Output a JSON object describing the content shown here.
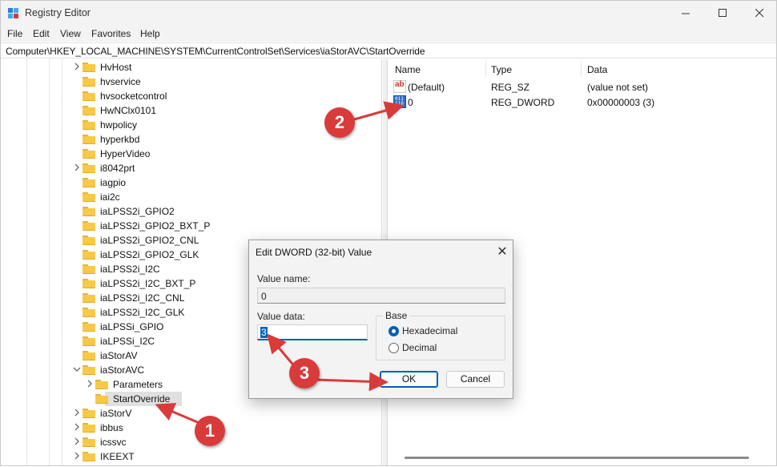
{
  "window": {
    "title": "Registry Editor",
    "minimize": "—",
    "maximize": "☐",
    "close": "✕"
  },
  "menu": [
    "File",
    "Edit",
    "View",
    "Favorites",
    "Help"
  ],
  "address": "Computer\\HKEY_LOCAL_MACHINE\\SYSTEM\\CurrentControlSet\\Services\\iaStorAVC\\StartOverride",
  "tree": [
    {
      "label": "HvHost",
      "expander": "collapsed"
    },
    {
      "label": "hvservice",
      "expander": "none"
    },
    {
      "label": "hvsocketcontrol",
      "expander": "none"
    },
    {
      "label": "HwNClx0101",
      "expander": "none"
    },
    {
      "label": "hwpolicy",
      "expander": "none"
    },
    {
      "label": "hyperkbd",
      "expander": "none"
    },
    {
      "label": "HyperVideo",
      "expander": "none"
    },
    {
      "label": "i8042prt",
      "expander": "collapsed"
    },
    {
      "label": "iagpio",
      "expander": "none"
    },
    {
      "label": "iai2c",
      "expander": "none"
    },
    {
      "label": "iaLPSS2i_GPIO2",
      "expander": "none"
    },
    {
      "label": "iaLPSS2i_GPIO2_BXT_P",
      "expander": "none"
    },
    {
      "label": "iaLPSS2i_GPIO2_CNL",
      "expander": "none"
    },
    {
      "label": "iaLPSS2i_GPIO2_GLK",
      "expander": "none"
    },
    {
      "label": "iaLPSS2i_I2C",
      "expander": "none"
    },
    {
      "label": "iaLPSS2i_I2C_BXT_P",
      "expander": "none"
    },
    {
      "label": "iaLPSS2i_I2C_CNL",
      "expander": "none"
    },
    {
      "label": "iaLPSS2i_I2C_GLK",
      "expander": "none"
    },
    {
      "label": "iaLPSSi_GPIO",
      "expander": "none"
    },
    {
      "label": "iaLPSSi_I2C",
      "expander": "none"
    },
    {
      "label": "iaStorAV",
      "expander": "none"
    },
    {
      "label": "iaStorAVC",
      "expander": "expanded"
    },
    {
      "label": "Parameters",
      "expander": "collapsed",
      "child": true
    },
    {
      "label": "StartOverride",
      "expander": "none",
      "child": true,
      "selected": true
    },
    {
      "label": "iaStorV",
      "expander": "collapsed"
    },
    {
      "label": "ibbus",
      "expander": "collapsed"
    },
    {
      "label": "icssvc",
      "expander": "collapsed"
    },
    {
      "label": "IKEEXT",
      "expander": "collapsed"
    }
  ],
  "columns": {
    "name": "Name",
    "type": "Type",
    "data": "Data"
  },
  "values": [
    {
      "icon": "string-value-icon",
      "icon_text": "ab",
      "name": "(Default)",
      "type": "REG_SZ",
      "data": "(value not set)"
    },
    {
      "icon": "binary-value-icon",
      "icon_text": "011 110",
      "name": "0",
      "type": "REG_DWORD",
      "data": "0x00000003 (3)"
    }
  ],
  "dialog": {
    "title": "Edit DWORD (32-bit) Value",
    "close": "✕",
    "value_name_label": "Value name:",
    "value_name": "0",
    "value_data_label": "Value data:",
    "value_data": "3",
    "base_label": "Base",
    "radio_hex": "Hexadecimal",
    "radio_dec": "Decimal",
    "base_selected": "Hexadecimal",
    "ok": "OK",
    "cancel": "Cancel"
  },
  "annotations": [
    "1",
    "2",
    "3"
  ],
  "colors": {
    "annotation": "#d93b3b",
    "accent": "#005fb8",
    "folder": "#f8c946"
  }
}
